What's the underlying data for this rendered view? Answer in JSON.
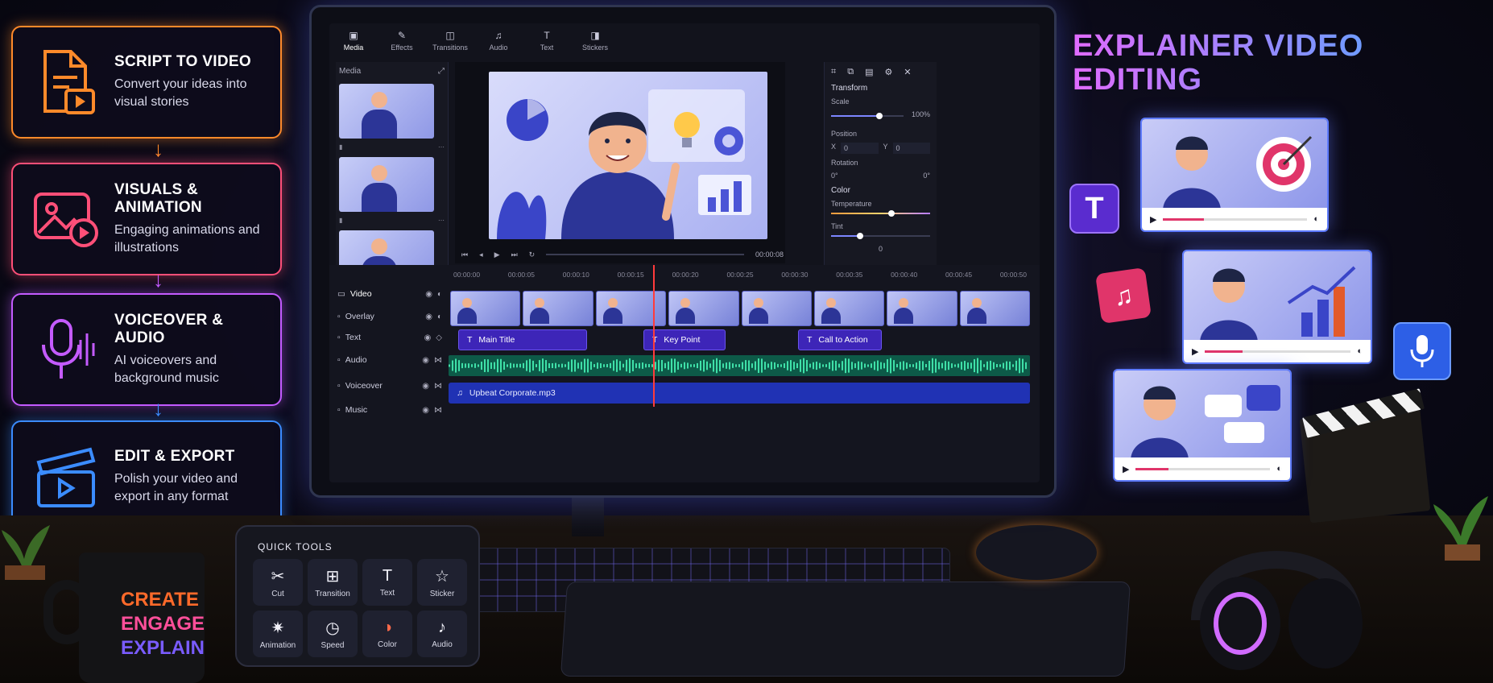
{
  "steps": [
    {
      "title": "SCRIPT TO VIDEO",
      "desc": "Convert your ideas into visual stories",
      "icon": "script-document-icon",
      "color": "#ff8a2a"
    },
    {
      "title": "VISUALS & ANIMATION",
      "desc": "Engaging animations and illustrations",
      "icon": "image-play-icon",
      "color": "#ff4f78"
    },
    {
      "title": "VOICEOVER & AUDIO",
      "desc": "AI voiceovers and background music",
      "icon": "microphone-icon",
      "color": "#c45bff"
    },
    {
      "title": "EDIT & EXPORT",
      "desc": "Polish your video and export in any format",
      "icon": "clapperboard-icon",
      "color": "#3b8cff"
    }
  ],
  "editor": {
    "tabs": [
      {
        "label": "Media",
        "icon": "media-icon"
      },
      {
        "label": "Effects",
        "icon": "effects-icon"
      },
      {
        "label": "Transitions",
        "icon": "transitions-icon"
      },
      {
        "label": "Audio",
        "icon": "audio-icon"
      },
      {
        "label": "Text",
        "icon": "text-icon"
      },
      {
        "label": "Stickers",
        "icon": "stickers-icon"
      }
    ],
    "media_title": "Media",
    "preview_time": "00:00:08",
    "properties": {
      "transform": "Transform",
      "scale_label": "Scale",
      "scale_value": "100%",
      "position_label": "Position",
      "x_label": "X",
      "x_value": "0",
      "y_label": "Y",
      "y_value": "0",
      "rotation_label": "Rotation",
      "rotation_value": "0°",
      "rotation_value_right": "0°",
      "color": "Color",
      "temperature_label": "Temperature",
      "tint_label": "Tint",
      "tint_value": "0"
    },
    "ruler": [
      "00:00:00",
      "00:00:05",
      "00:00:10",
      "00:00:15",
      "00:00:20",
      "00:00:25",
      "00:00:30",
      "00:00:35",
      "00:00:40",
      "00:00:45",
      "00:00:50"
    ],
    "tracks": [
      "Video",
      "Overlay",
      "Text",
      "Audio",
      "Voiceover",
      "Music"
    ],
    "text_clips": [
      "Main Title",
      "Key Point",
      "Call to Action"
    ],
    "music_clip": "Upbeat Corporate.mp3"
  },
  "headline": {
    "line1": "EXPLAINER VIDEO",
    "line2": "EDITING"
  },
  "quick_tools": {
    "title": "QUICK TOOLS",
    "tools": [
      {
        "label": "Cut",
        "icon": "scissors-icon"
      },
      {
        "label": "Transition",
        "icon": "transition-grid-icon"
      },
      {
        "label": "Text",
        "icon": "text-icon"
      },
      {
        "label": "Sticker",
        "icon": "star-icon"
      },
      {
        "label": "Animation",
        "icon": "sparkle-icon"
      },
      {
        "label": "Speed",
        "icon": "speedometer-icon"
      },
      {
        "label": "Color",
        "icon": "color-palette-icon"
      },
      {
        "label": "Audio",
        "icon": "audio-note-icon"
      }
    ]
  },
  "mug": {
    "lines": [
      "CREATE",
      "ENGAGE",
      "EXPLAIN"
    ]
  },
  "colors": {
    "accent": "#7c86ff",
    "playhead": "#ff3b3b",
    "text_clip": "#3d25b8",
    "music_track": "#2032b4",
    "voiceover_track": "#0d5a48"
  }
}
